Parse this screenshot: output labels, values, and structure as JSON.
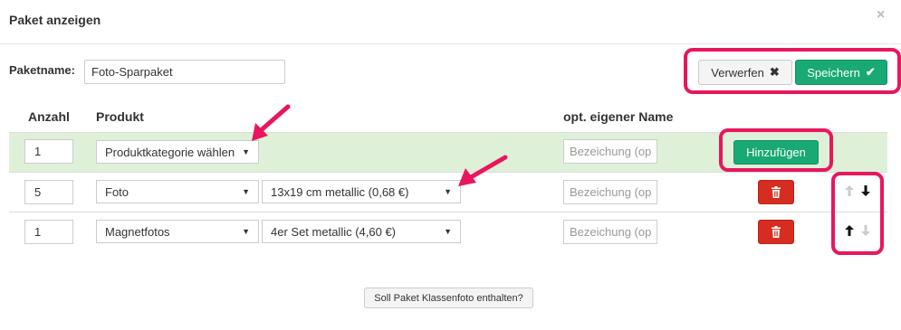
{
  "dialog": {
    "title": "Paket anzeigen",
    "close_icon": "×"
  },
  "package": {
    "label": "Paketname:",
    "value": "Foto-Sparpaket"
  },
  "actions": {
    "discard_label": "Verwerfen",
    "discard_icon": "✖",
    "save_label": "Speichern",
    "save_icon": "✔"
  },
  "table": {
    "headers": {
      "qty": "Anzahl",
      "product": "Produkt",
      "name": "opt. eigener Name"
    },
    "new_row": {
      "qty": "1",
      "category": "Produktkategorie wählen",
      "name_placeholder": "Bezeichung (op",
      "add_label": "Hinzufügen"
    },
    "rows": [
      {
        "qty": "5",
        "category": "Foto",
        "variant": "13x19 cm metallic (0,68 €)",
        "name_placeholder": "Bezeichung (op"
      },
      {
        "qty": "1",
        "category": "Magnetfotos",
        "variant": "4er Set metallic (4,60 €)",
        "name_placeholder": "Bezeichung (op"
      }
    ]
  },
  "footer": {
    "class_photo_label": "Soll Paket Klassenfoto enthalten?"
  },
  "colors": {
    "accent_green": "#19a974",
    "delete_red": "#d62d20",
    "highlight_pink": "#e8175d",
    "row_green": "#dff0d8"
  },
  "icons": {
    "caret": "▼",
    "arrow_up": "🡑",
    "arrow_down": "🡓"
  }
}
